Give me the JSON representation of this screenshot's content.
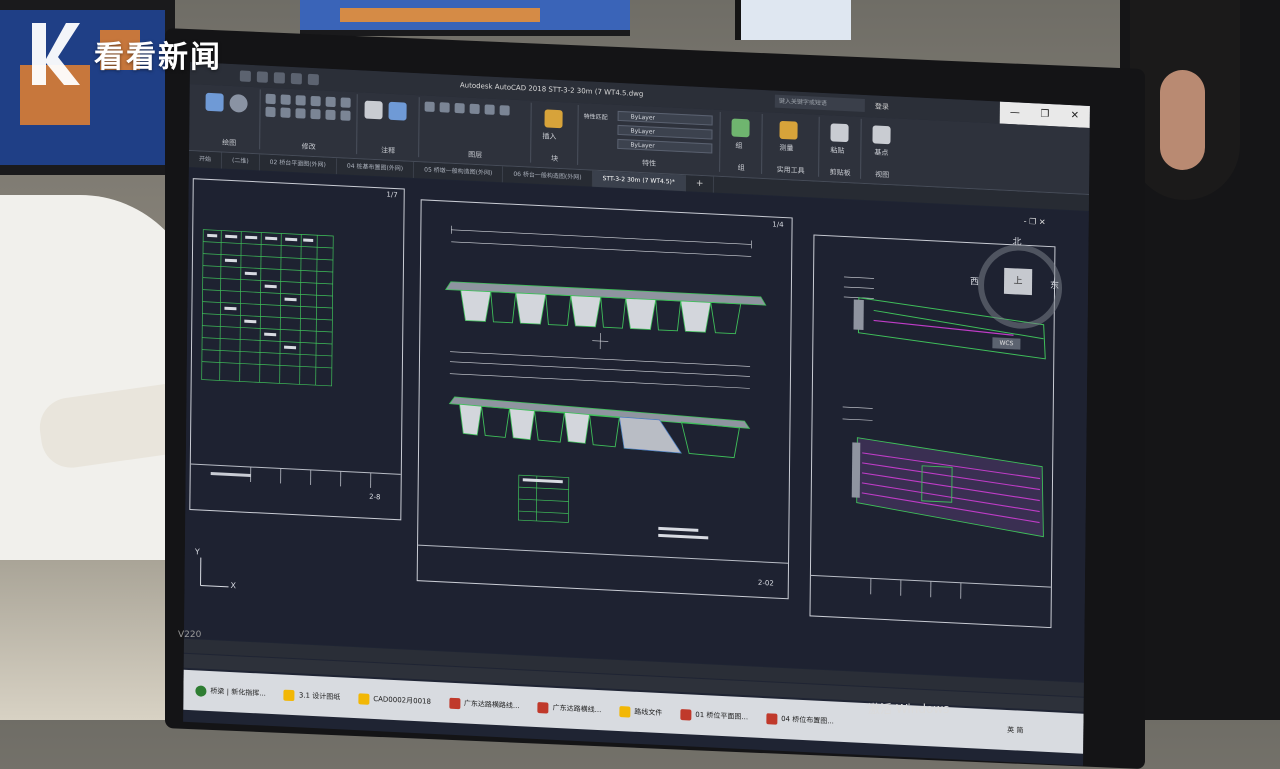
{
  "watermark": {
    "brand_text": "看看新闻"
  },
  "monitor": {
    "model": "V220"
  },
  "autocad": {
    "window_title": "Autodesk AutoCAD 2018   STT-3-2 30m (7 WT4.5.dwg",
    "search_placeholder": "键入关键字或短语",
    "sign_in": "登录",
    "window_controls": [
      "—",
      "❐",
      "✕"
    ],
    "ribbon_groups": [
      {
        "label": "绘图"
      },
      {
        "label": "修改"
      },
      {
        "label": "注释"
      },
      {
        "label": "图层"
      },
      {
        "label": "块"
      },
      {
        "label": "特性"
      },
      {
        "label": "组"
      },
      {
        "label": "实用工具"
      },
      {
        "label": "剪贴板"
      },
      {
        "label": "视图"
      }
    ],
    "property_combos": [
      "ByLayer",
      "ByLayer",
      "ByLayer"
    ],
    "ribbon_buttons": {
      "insert": "插入",
      "match": "特性匹配",
      "group": "组",
      "measure": "测量",
      "paste": "粘贴",
      "base": "基点"
    },
    "doc_tabs": [
      {
        "label": "开始"
      },
      {
        "label": "(二维)"
      },
      {
        "label": "02 桥台平面图(外网)"
      },
      {
        "label": "04 桩基布置图(外网)"
      },
      {
        "label": "05 桥墩一般构造图(外网)"
      },
      {
        "label": "06 桥台一般构造图(外网)"
      },
      {
        "label": "STT-3-2 30m (7 WT4.5)*",
        "active": true
      }
    ],
    "doc_tab_add": "+",
    "sheets": {
      "left_number": "2-8",
      "middle_number": "2-02",
      "middle_top_number": "1/4",
      "left_top_number": "1/7"
    },
    "viewport_controls": "- ❐ ✕",
    "compass": {
      "north": "北",
      "west": "西",
      "east": "东",
      "top": "上"
    },
    "wcs_label": "WCS",
    "ucs": {
      "y": "Y",
      "x": "X"
    }
  },
  "taskbar": {
    "items": [
      {
        "label": "桥梁 | 新化指挥...",
        "color": "#2e7d32"
      },
      {
        "label": "3.1 设计图纸",
        "color": "#f2b705"
      },
      {
        "label": "CAD0002月0018",
        "color": "#f2b705"
      },
      {
        "label": "广东达路横路线...",
        "color": "#c0392b"
      },
      {
        "label": "广东达路横线...",
        "color": "#c0392b"
      },
      {
        "label": "路线文件",
        "color": "#f2b705"
      },
      {
        "label": "01 桥位平面图...",
        "color": "#c0392b"
      },
      {
        "label": "04 桥位布置图...",
        "color": "#c0392b"
      }
    ],
    "tray_text": "英 简"
  },
  "activation_text": "激活 Windows"
}
